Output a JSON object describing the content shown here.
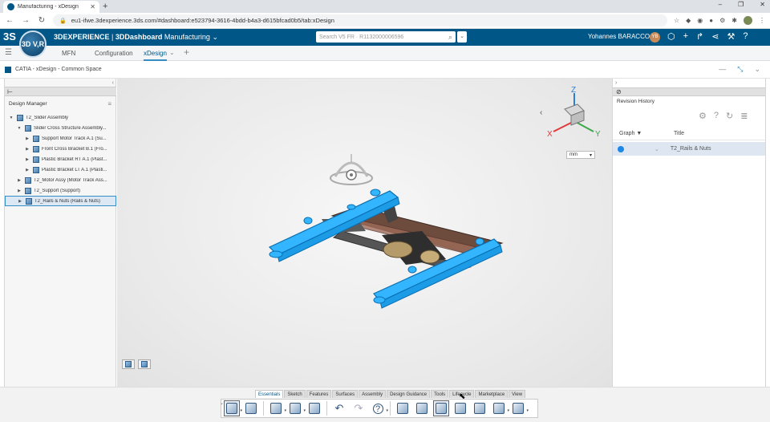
{
  "browser": {
    "tab_title": "Manufacturing - xDesign",
    "new_tab": "+",
    "url": "eu1-ifwe.3dexperience.3ds.com/#dashboard:e523794-3616-4bdd-b4a3-d615bfcad0b5/tab:xDesign",
    "window_controls": [
      "–",
      "❐",
      "✕"
    ]
  },
  "topbar": {
    "brand_prefix": "3DEXPERIENCE",
    "brand_app": "3DDashboard",
    "brand_context": "Manufacturing",
    "compass_label": "3D V,R",
    "search_placeholder": "Search V5 FR · R1132000006596",
    "user_name": "Yohannes BARACCO",
    "user_initials": "YB"
  },
  "dashboard_tabs": [
    {
      "label": "MFN",
      "active": false
    },
    {
      "label": "Configuration",
      "active": false
    },
    {
      "label": "xDesign",
      "active": true
    }
  ],
  "app": {
    "title": "CATIA - xDesign - Common Space"
  },
  "design_manager": {
    "title": "Design Manager",
    "tree": [
      {
        "label": "T2_Slider Assembly",
        "level": 0,
        "toggle": "▼",
        "selected": false
      },
      {
        "label": "Slider Cross Structure Assembly...",
        "level": 1,
        "toggle": "▼",
        "selected": false
      },
      {
        "label": "Support Motor Track A.1 (Su...",
        "level": 2,
        "toggle": "▶",
        "selected": false
      },
      {
        "label": "Front Cross Bracket B.1 (Fro...",
        "level": 2,
        "toggle": "▶",
        "selected": false
      },
      {
        "label": "Plastic Bracket RT A.1 (Plast...",
        "level": 2,
        "toggle": "▶",
        "selected": false
      },
      {
        "label": "Plastic Bracket LT A.1 (Plasti...",
        "level": 2,
        "toggle": "▶",
        "selected": false
      },
      {
        "label": "T2_Motor Assy (Motor Track Ass...",
        "level": 1,
        "toggle": "▶",
        "selected": false
      },
      {
        "label": "T2_Support (Support)",
        "level": 1,
        "toggle": "▶",
        "selected": false
      },
      {
        "label": "T2_Rails & Nuts (Rails & Nuts)",
        "level": 1,
        "toggle": "▶",
        "selected": true
      }
    ]
  },
  "viewport": {
    "units": "mm",
    "axis_labels": {
      "x": "X",
      "y": "Y",
      "z": "Z"
    }
  },
  "revision_history": {
    "title": "Revision History",
    "columns": [
      "Graph",
      "Title"
    ],
    "sort_indicator": "▼",
    "rows": [
      {
        "title": "T2_Rails & Nuts"
      }
    ]
  },
  "action_bar": {
    "tabs": [
      "Essentials",
      "Sketch",
      "Features",
      "Surfaces",
      "Assembly",
      "Design Guidance",
      "Tools",
      "Lifecycle",
      "Marketplace",
      "View"
    ],
    "active_tab": "Essentials"
  },
  "colors": {
    "brand_blue": "#005686",
    "accent": "#368ec4",
    "highlight": "#33b5ff"
  }
}
